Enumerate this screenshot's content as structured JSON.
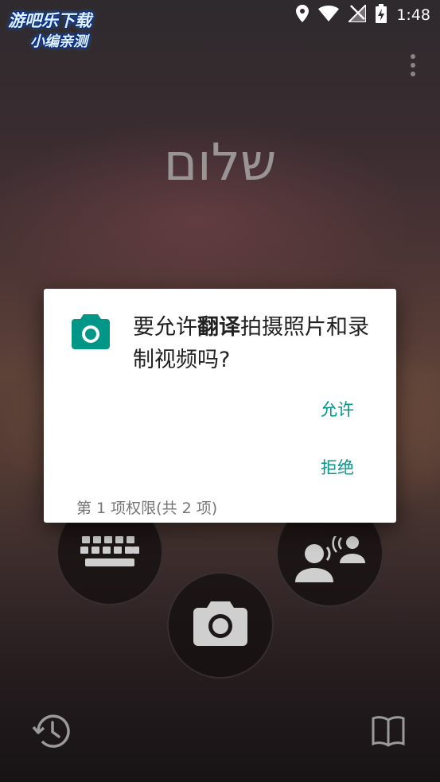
{
  "status_bar": {
    "time": "1:48",
    "icons": [
      "location-icon",
      "wifi-icon",
      "no-signal-icon",
      "battery-charging-icon"
    ]
  },
  "watermark": {
    "line1": "游吧乐下载",
    "line2": "小编亲测"
  },
  "main": {
    "greeting": "שלום",
    "menu_icon": "overflow-menu-icon",
    "input_buttons": [
      "keyboard-icon",
      "conversation-icon",
      "camera-icon"
    ],
    "bottom_left_icon": "history-icon",
    "bottom_right_icon": "phrasebook-icon"
  },
  "dialog": {
    "icon": "camera-icon",
    "message_before": "要允许",
    "app_name": "翻译",
    "message_after": "拍摄照片和录制视频吗?",
    "allow_label": "允许",
    "deny_label": "拒绝",
    "footer": "第 1 项权限(共 2 项)",
    "accent_color": "#009688"
  }
}
